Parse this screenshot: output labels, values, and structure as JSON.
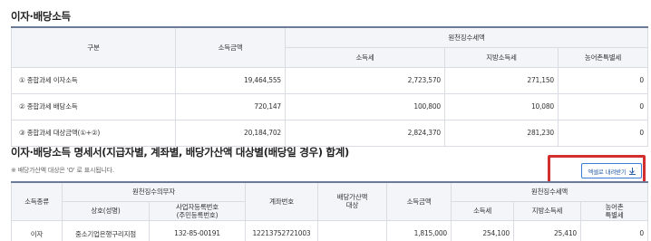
{
  "section1": {
    "title": "이자·배당소득",
    "headers": {
      "category": "구분",
      "income": "소득금액",
      "withholding_group": "원천징수세액",
      "income_tax": "소득세",
      "local_tax": "지방소득세",
      "rural_tax": "농어촌특별세"
    },
    "rows": [
      {
        "label": "① 종합과세 이자소득",
        "income": "19,464,555",
        "income_tax": "2,723,570",
        "local_tax": "271,150",
        "rural_tax": "0"
      },
      {
        "label": "② 종합과세 배당소득",
        "income": "720,147",
        "income_tax": "100,800",
        "local_tax": "10,080",
        "rural_tax": "0"
      },
      {
        "label": "③ 종합과세 대상금액(①+②)",
        "income": "20,184,702",
        "income_tax": "2,824,370",
        "local_tax": "281,230",
        "rural_tax": "0"
      }
    ]
  },
  "section2": {
    "title": "이자·배당소득 명세서(지급자별, 계좌별, 배당가산액 대상별(배당일 경우) 합계)",
    "note": "※ 배당가산액 대상은 'O' 로 표시됩니다.",
    "download_label": "엑셀로 내려받기",
    "download_icon": "download-icon",
    "highlight_color": "#d32f2f",
    "headers": {
      "income_type": "소득종류",
      "payer_group": "원천징수의무자",
      "trade_name": "상호(성명)",
      "biz_reg_no": "사업자등록번호\n(주민등록번호)",
      "account_no": "계좌번호",
      "dividend_target": "배당가산액\n대상",
      "income": "소득금액",
      "withholding_group": "원천징수세액",
      "income_tax": "소득세",
      "local_tax": "지방소득세",
      "rural_tax": "농어촌\n특별세"
    },
    "rows": [
      {
        "income_type": "이자",
        "trade_name": "중소기업은행구리지점",
        "biz_reg_no": "132-85-00191",
        "account_no": "12213752721003",
        "dividend_target": "",
        "income": "1,815,000",
        "income_tax": "254,100",
        "local_tax": "25,410",
        "rural_tax": "0"
      }
    ]
  }
}
